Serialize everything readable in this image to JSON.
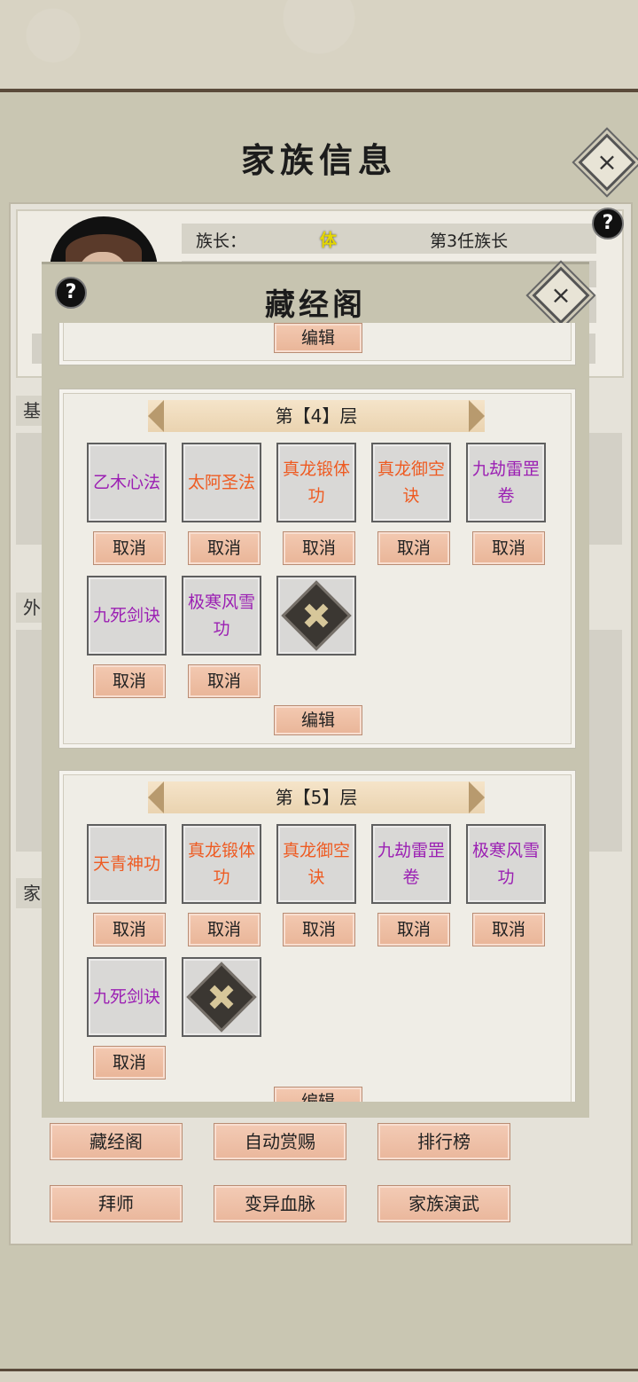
{
  "header": {
    "title": "家族信息",
    "close_icon": "×"
  },
  "info": {
    "chief_label": "族长：",
    "chief_tag": "体",
    "chief_rank": "第3任族长",
    "help": "?",
    "side_labels": [
      "基",
      "外",
      "家"
    ]
  },
  "bottom_buttons": [
    "藏经阁",
    "自动赏赐",
    "排行榜",
    "拜师",
    "变异血脉",
    "家族演武"
  ],
  "modal": {
    "title": "藏经阁",
    "help": "?",
    "close_icon": "×",
    "edit_label": "编辑",
    "cancel_label": "取消",
    "floors": [
      {
        "label": "第【4】层",
        "items": [
          {
            "name": "乙木心法",
            "color": "purple"
          },
          {
            "name": "太阿圣法",
            "color": "orange"
          },
          {
            "name": "真龙锻体功",
            "color": "orange"
          },
          {
            "name": "真龙御空诀",
            "color": "orange"
          },
          {
            "name": "九劫雷罡卷",
            "color": "purple"
          },
          {
            "name": "九死剑诀",
            "color": "purple"
          },
          {
            "name": "极寒风雪功",
            "color": "purple"
          }
        ]
      },
      {
        "label": "第【5】层",
        "items": [
          {
            "name": "天青神功",
            "color": "orange"
          },
          {
            "name": "真龙锻体功",
            "color": "orange"
          },
          {
            "name": "真龙御空诀",
            "color": "orange"
          },
          {
            "name": "九劫雷罡卷",
            "color": "purple"
          },
          {
            "name": "极寒风雪功",
            "color": "purple"
          },
          {
            "name": "九死剑诀",
            "color": "purple"
          }
        ]
      }
    ]
  },
  "colors": {
    "orange": "#ee5b22",
    "purple": "#9b1fb3"
  }
}
